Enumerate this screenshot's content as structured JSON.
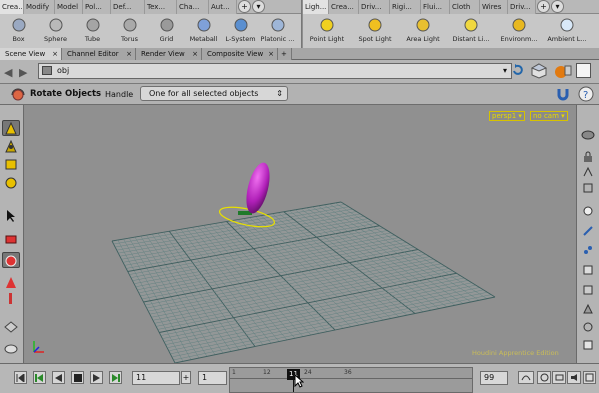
{
  "shelf_left": {
    "tabs": [
      "Crea...",
      "Modify",
      "Model",
      "Pol...",
      "Def...",
      "Tex...",
      "Cha...",
      "Aut..."
    ],
    "tools": [
      {
        "label": "Box",
        "icon": "box-icon"
      },
      {
        "label": "Sphere",
        "icon": "sphere-icon"
      },
      {
        "label": "Tube",
        "icon": "tube-icon"
      },
      {
        "label": "Torus",
        "icon": "torus-icon"
      },
      {
        "label": "Grid",
        "icon": "grid-icon"
      },
      {
        "label": "Metaball",
        "icon": "metaball-icon"
      },
      {
        "label": "L-System",
        "icon": "lsystem-icon"
      },
      {
        "label": "Platonic ...",
        "icon": "platonic-icon"
      }
    ]
  },
  "shelf_right": {
    "tabs": [
      "Ligh...",
      "Crea...",
      "Driv...",
      "Rigi...",
      "Flui...",
      "Cloth",
      "Wires",
      "Driv..."
    ],
    "tools": [
      {
        "label": "Point Light",
        "icon": "point-light-icon"
      },
      {
        "label": "Spot Light",
        "icon": "spot-light-icon"
      },
      {
        "label": "Area Light",
        "icon": "area-light-icon"
      },
      {
        "label": "Distant Li...",
        "icon": "distant-light-icon"
      },
      {
        "label": "Environm...",
        "icon": "environment-light-icon"
      },
      {
        "label": "Ambient L...",
        "icon": "ambient-light-icon"
      }
    ]
  },
  "pane_tabs": [
    "Scene View",
    "Channel Editor",
    "Render View",
    "Composite View"
  ],
  "path": "obj",
  "op": {
    "title": "Rotate Objects",
    "handle_label": "Handle",
    "handle_value": "One for all selected objects"
  },
  "viewport": {
    "camera": "persp1",
    "cam_option": "no cam",
    "watermark": "Houdini Apprentice Edition"
  },
  "playbar": {
    "frame": "11",
    "start": "1",
    "end": "99",
    "current_frame_marker": "11",
    "ticks": [
      "1",
      "12",
      "24",
      "36"
    ]
  },
  "colors": {
    "geometry": "#b020b8",
    "handle": "#e8e000",
    "grid": "#5f7f7f"
  }
}
